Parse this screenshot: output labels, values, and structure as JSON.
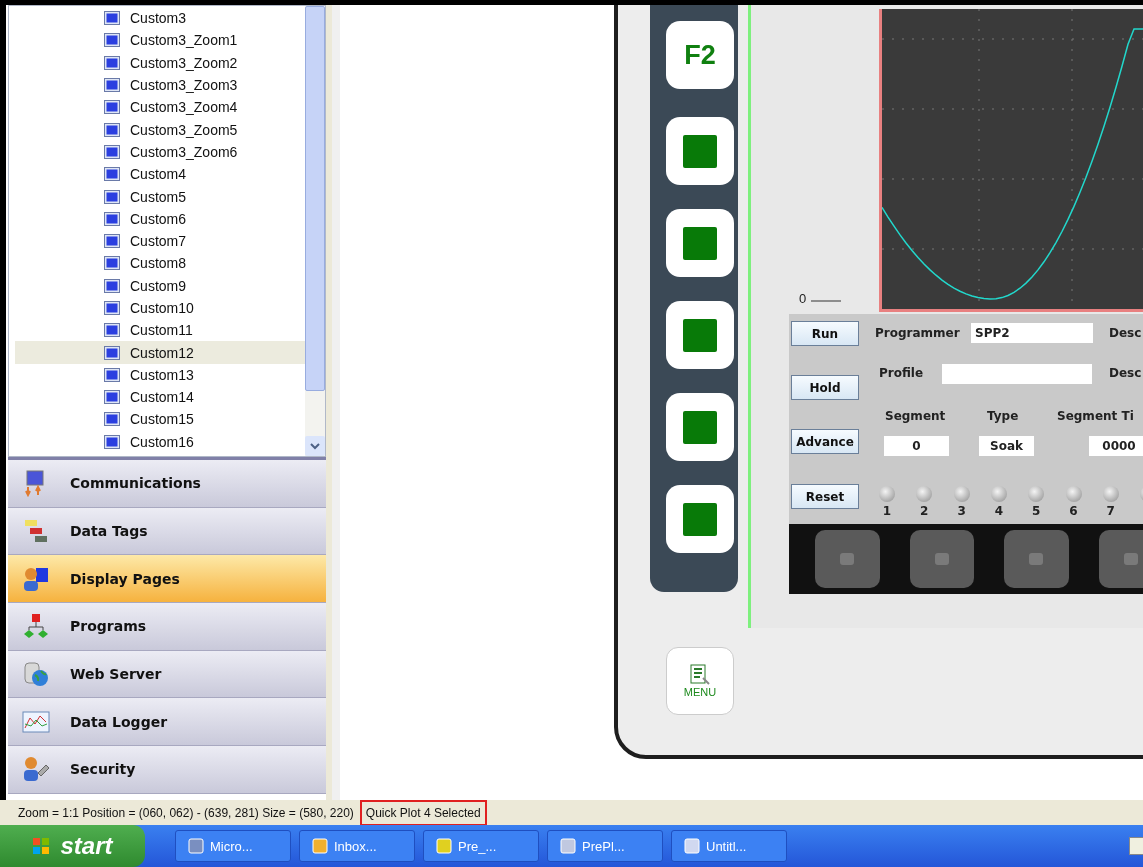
{
  "tree": {
    "items": [
      {
        "label": "Custom3",
        "selected": false
      },
      {
        "label": "Custom3_Zoom1",
        "selected": false
      },
      {
        "label": "Custom3_Zoom2",
        "selected": false
      },
      {
        "label": "Custom3_Zoom3",
        "selected": false
      },
      {
        "label": "Custom3_Zoom4",
        "selected": false
      },
      {
        "label": "Custom3_Zoom5",
        "selected": false
      },
      {
        "label": "Custom3_Zoom6",
        "selected": false
      },
      {
        "label": "Custom4",
        "selected": false
      },
      {
        "label": "Custom5",
        "selected": false
      },
      {
        "label": "Custom6",
        "selected": false
      },
      {
        "label": "Custom7",
        "selected": false
      },
      {
        "label": "Custom8",
        "selected": false
      },
      {
        "label": "Custom9",
        "selected": false
      },
      {
        "label": "Custom10",
        "selected": false
      },
      {
        "label": "Custom11",
        "selected": false
      },
      {
        "label": "Custom12",
        "selected": true
      },
      {
        "label": "Custom13",
        "selected": false
      },
      {
        "label": "Custom14",
        "selected": false
      },
      {
        "label": "Custom15",
        "selected": false
      },
      {
        "label": "Custom16",
        "selected": false
      }
    ]
  },
  "nav": [
    {
      "label": "Communications",
      "selected": false
    },
    {
      "label": "Data Tags",
      "selected": false
    },
    {
      "label": "Display Pages",
      "selected": true
    },
    {
      "label": "Programs",
      "selected": false
    },
    {
      "label": "Web Server",
      "selected": false
    },
    {
      "label": "Data Logger",
      "selected": false
    },
    {
      "label": "Security",
      "selected": false
    }
  ],
  "device": {
    "function_keys": [
      {
        "kind": "text",
        "label": "F2"
      },
      {
        "kind": "square"
      },
      {
        "kind": "square"
      },
      {
        "kind": "square"
      },
      {
        "kind": "square"
      },
      {
        "kind": "square"
      }
    ],
    "menu_button": "MENU",
    "plot": {
      "axis_label": "0"
    },
    "controls": {
      "buttons": [
        "Run",
        "Hold",
        "Advance",
        "Reset"
      ],
      "programmer": {
        "label": "Programmer",
        "value": "SPP2",
        "desc": "Desc"
      },
      "profile": {
        "label": "Profile",
        "desc": "Desc"
      },
      "segment": {
        "headers": [
          "Segment",
          "Type",
          "Segment Ti"
        ],
        "values": [
          "0",
          "Soak",
          "0000"
        ]
      },
      "lamps": [
        {
          "kind": "lamp",
          "number": "1"
        },
        {
          "kind": "lamp",
          "number": "2"
        },
        {
          "kind": "lamp",
          "number": "3"
        },
        {
          "kind": "lamp",
          "number": "4"
        },
        {
          "kind": "lamp",
          "number": "5"
        },
        {
          "kind": "lamp",
          "number": "6"
        },
        {
          "kind": "lamp",
          "number": "7"
        },
        {
          "kind": "lamp"
        }
      ]
    }
  },
  "status_bar": {
    "info": "Zoom = 1:1  Position = (060, 062) - (639, 281)  Size = (580, 220)",
    "selection": "Quick Plot 4 Selected",
    "highlighted": true
  },
  "taskbar": {
    "start": "start",
    "items": [
      "Micro...",
      "Inbox...",
      "Pre_...",
      "PrePl...",
      "Untitl..."
    ]
  }
}
